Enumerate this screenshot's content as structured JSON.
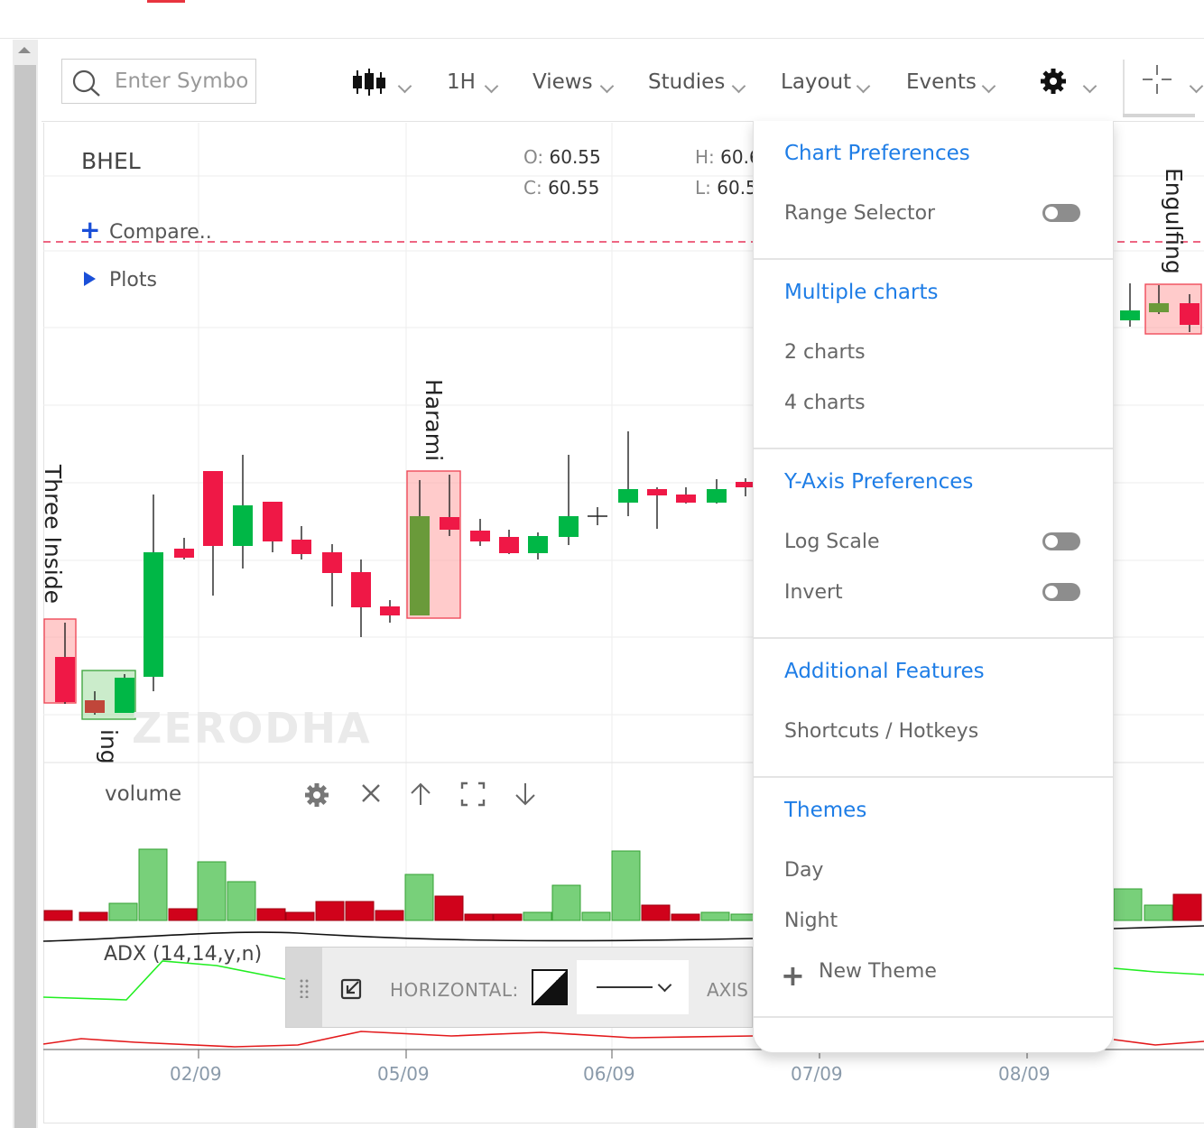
{
  "toolbar": {
    "search_placeholder": "Enter Symbol",
    "interval": "1H",
    "views": "Views",
    "studies": "Studies",
    "layout": "Layout",
    "events": "Events"
  },
  "chart": {
    "symbol": "BHEL",
    "compare": "Compare..",
    "plots": "Plots",
    "ohlc": {
      "o_label": "O:",
      "o": "60.55",
      "c_label": "C:",
      "c": "60.55",
      "h_label": "H:",
      "h": "60.6",
      "l_label": "L:",
      "l": "60.5"
    },
    "patterns": [
      "Three Inside",
      "ing",
      "Harami",
      "Engulfing"
    ],
    "watermark": "ZERODHA",
    "volume_label": "volume",
    "adx_label": "ADX (14,14,y,n)",
    "x_ticks": [
      "02/09",
      "05/09",
      "06/09",
      "07/09",
      "08/09"
    ],
    "colors": {
      "up": "#00b746",
      "down": "#ef1846",
      "vol_up": "#78d07a",
      "vol_down": "#d0021b",
      "adx_green": "#22ee22",
      "adx_red": "#e31a1c"
    }
  },
  "drawing_toolbar": {
    "horizontal_label": "HORIZONTAL:",
    "axis_label": "AXIS"
  },
  "menu": {
    "sections": [
      {
        "heading": "Chart Preferences",
        "items": [
          {
            "label": "Range Selector",
            "toggle": false
          }
        ]
      },
      {
        "heading": "Multiple charts",
        "items": [
          {
            "label": "2 charts"
          },
          {
            "label": "4 charts"
          }
        ]
      },
      {
        "heading": "Y-Axis Preferences",
        "items": [
          {
            "label": "Log Scale",
            "toggle": false
          },
          {
            "label": "Invert",
            "toggle": false
          }
        ]
      },
      {
        "heading": "Additional Features",
        "items": [
          {
            "label": "Shortcuts / Hotkeys"
          }
        ]
      },
      {
        "heading": "Themes",
        "items": [
          {
            "label": "Day"
          },
          {
            "label": "Night"
          },
          {
            "label": "New Theme"
          }
        ]
      }
    ]
  }
}
